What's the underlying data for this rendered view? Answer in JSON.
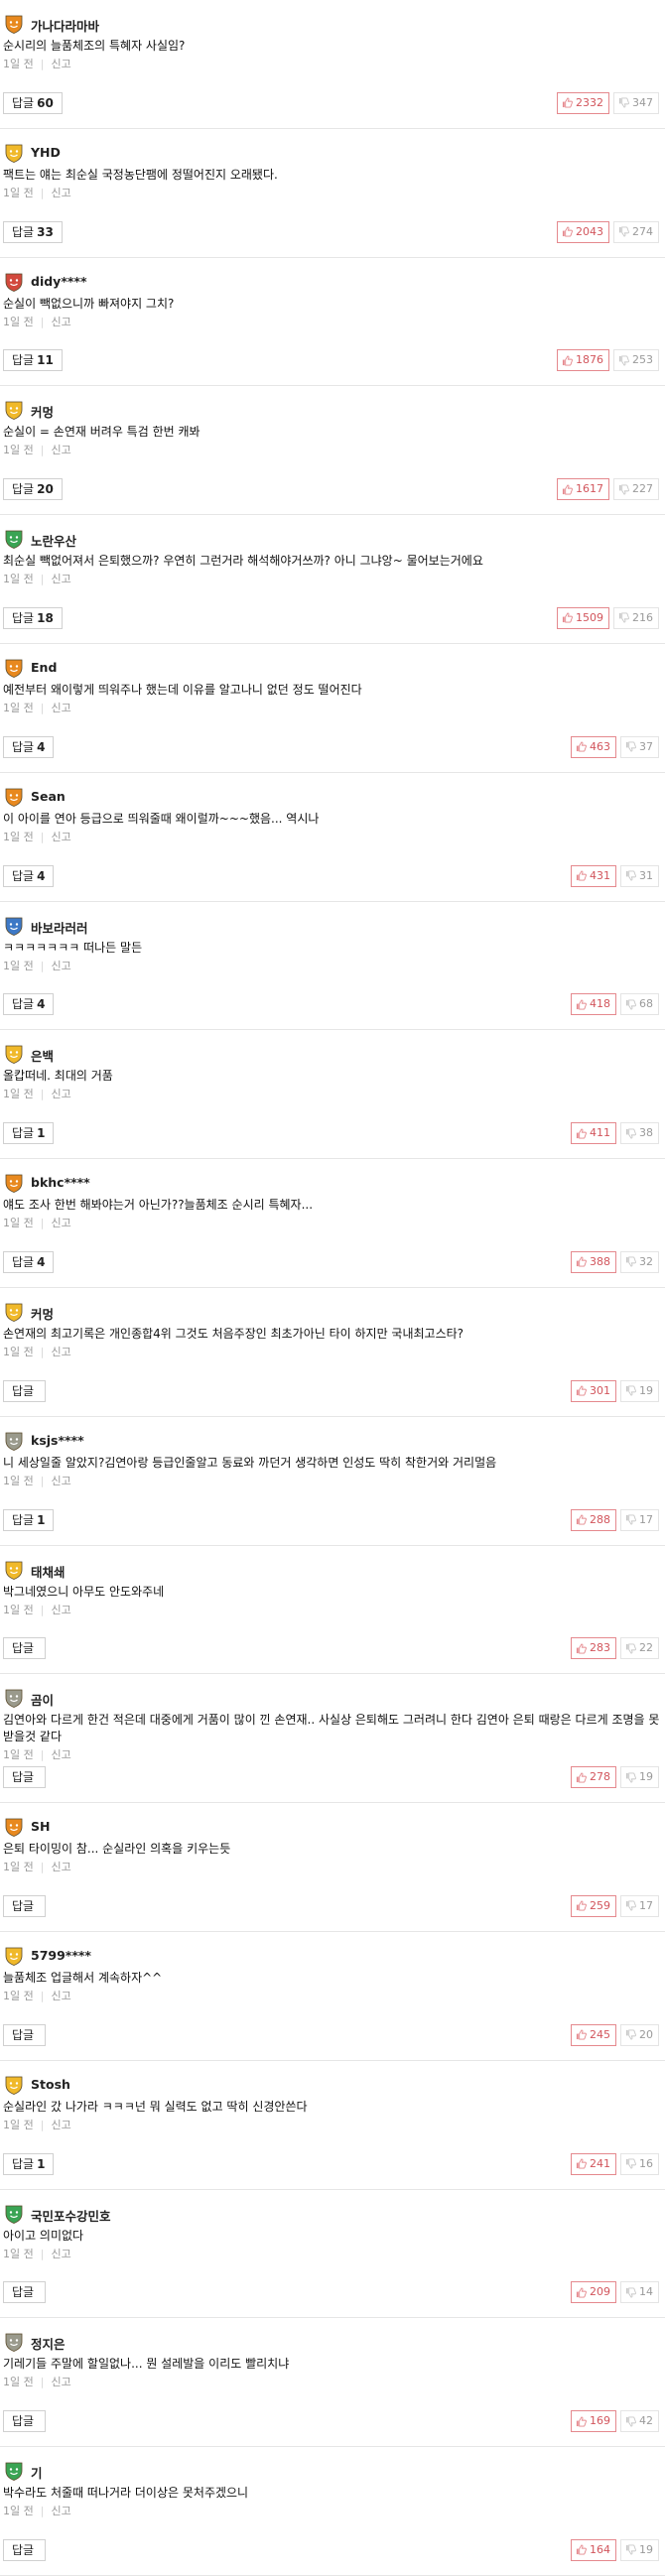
{
  "ui": {
    "reply_label": "답글",
    "report_label": "신고"
  },
  "colors": {
    "badge_orange": "#e8891f",
    "badge_gold": "#f0b92a",
    "badge_green": "#3aa454",
    "badge_gray": "#9a9a8c",
    "badge_blue": "#3d78c6",
    "badge_red": "#d2493d",
    "upvote_border": "#e5898e",
    "upvote_text": "#d2555c"
  },
  "comments": [
    {
      "user": "가나다라마바",
      "badge": "orange",
      "text": "순시리의 늘품체조의 특혜자 사실임?",
      "time": "1일 전",
      "replies": "60",
      "up": "2332",
      "down": "347"
    },
    {
      "user": "YHD",
      "badge": "gold",
      "text": "팩트는 얘는 최순실 국정농단팸에 정떨어진지 오래됐다.",
      "time": "1일 전",
      "replies": "33",
      "up": "2043",
      "down": "274"
    },
    {
      "user": "didy****",
      "badge": "red",
      "text": "순실이 빽없으니까 빠져야지 그치?",
      "time": "1일 전",
      "replies": "11",
      "up": "1876",
      "down": "253"
    },
    {
      "user": "커멍",
      "badge": "gold",
      "text": "순실이 = 손연재 버려우 특검 한번 캐봐",
      "time": "1일 전",
      "replies": "20",
      "up": "1617",
      "down": "227"
    },
    {
      "user": "노란우산",
      "badge": "green",
      "text": "최순실 빽없어져서 은퇴했으까? 우연히 그런거라 해석해야거쓰까? 아니 그냐앙~ 물어보는거에요",
      "time": "1일 전",
      "replies": "18",
      "up": "1509",
      "down": "216"
    },
    {
      "user": "End",
      "badge": "orange",
      "text": "예전부터 왜이렇게 띄워주나 했는데 이유를 알고나니 없던 정도 떨어진다",
      "time": "1일 전",
      "replies": "4",
      "up": "463",
      "down": "37"
    },
    {
      "user": "Sean",
      "badge": "orange",
      "text": "이 아이를 연아 등급으로 띄워줄때 왜이럴까~~~했음... 역시나",
      "time": "1일 전",
      "replies": "4",
      "up": "431",
      "down": "31"
    },
    {
      "user": "바보라러러",
      "badge": "blue",
      "text": "ㅋㅋㅋㅋㅋㅋㅋ 떠나든 말든",
      "time": "1일 전",
      "replies": "4",
      "up": "418",
      "down": "68"
    },
    {
      "user": "은백",
      "badge": "gold",
      "text": "올캅떠네. 최대의 거품",
      "time": "1일 전",
      "replies": "1",
      "up": "411",
      "down": "38"
    },
    {
      "user": "bkhc****",
      "badge": "orange",
      "text": "얘도 조사 한번 해봐야는거 아닌가??늘품체조 순시리 특혜자...",
      "time": "1일 전",
      "replies": "4",
      "up": "388",
      "down": "32"
    },
    {
      "user": "커멍",
      "badge": "gold",
      "text": "손연재의 최고기록은 개인종합4위 그것도 처음주장인 최초가아닌 타이 하지만 국내최고스타?",
      "time": "1일 전",
      "replies": "",
      "up": "301",
      "down": "19"
    },
    {
      "user": "ksjs****",
      "badge": "gray",
      "text": "니 세상일줄 알았지?김연아랑 등급인줄알고 동료와 까던거 생각하면 인성도 딱히 착한거와 거리멀음",
      "time": "1일 전",
      "replies": "1",
      "up": "288",
      "down": "17"
    },
    {
      "user": "태채쇄",
      "badge": "gold",
      "text": "박그네였으니 아무도 안도와주네",
      "time": "1일 전",
      "replies": "",
      "up": "283",
      "down": "22"
    },
    {
      "user": "곰이",
      "badge": "gray",
      "text": "김연아와 다르게 한건 적은데 대중에게 거품이 많이 낀 손연재.. 사실상 은퇴해도 그러려니 한다 김연아 은퇴 때랑은 다르게 조명을 못받을것 같다",
      "time": "1일 전",
      "replies": "",
      "up": "278",
      "down": "19"
    },
    {
      "user": "SH",
      "badge": "orange",
      "text": "은퇴 타이밍이 참... 순실라인 의혹을 키우는듯",
      "time": "1일 전",
      "replies": "",
      "up": "259",
      "down": "17"
    },
    {
      "user": "5799****",
      "badge": "gold",
      "text": "늘품체조 업글해서 계속하자^^",
      "time": "1일 전",
      "replies": "",
      "up": "245",
      "down": "20"
    },
    {
      "user": "Stosh",
      "badge": "gold",
      "text": "순실라인 갔 나가라 ㅋㅋㅋ넌 뭐 실력도 없고 딱히 신경안쓴다",
      "time": "1일 전",
      "replies": "1",
      "up": "241",
      "down": "16"
    },
    {
      "user": "국민포수강민호",
      "badge": "green",
      "text": "아이고 의미없다",
      "time": "1일 전",
      "replies": "",
      "up": "209",
      "down": "14"
    },
    {
      "user": "정지은",
      "badge": "gray",
      "text": "기레기들 주말에 할일없나... 뭔 설레발을 이리도 빨리치냐",
      "time": "1일 전",
      "replies": "",
      "up": "169",
      "down": "42"
    },
    {
      "user": "기",
      "badge": "green",
      "text": "박수라도 처줄때 떠나거라 더이상은 못처주겠으니",
      "time": "1일 전",
      "replies": "",
      "up": "164",
      "down": "19"
    }
  ]
}
